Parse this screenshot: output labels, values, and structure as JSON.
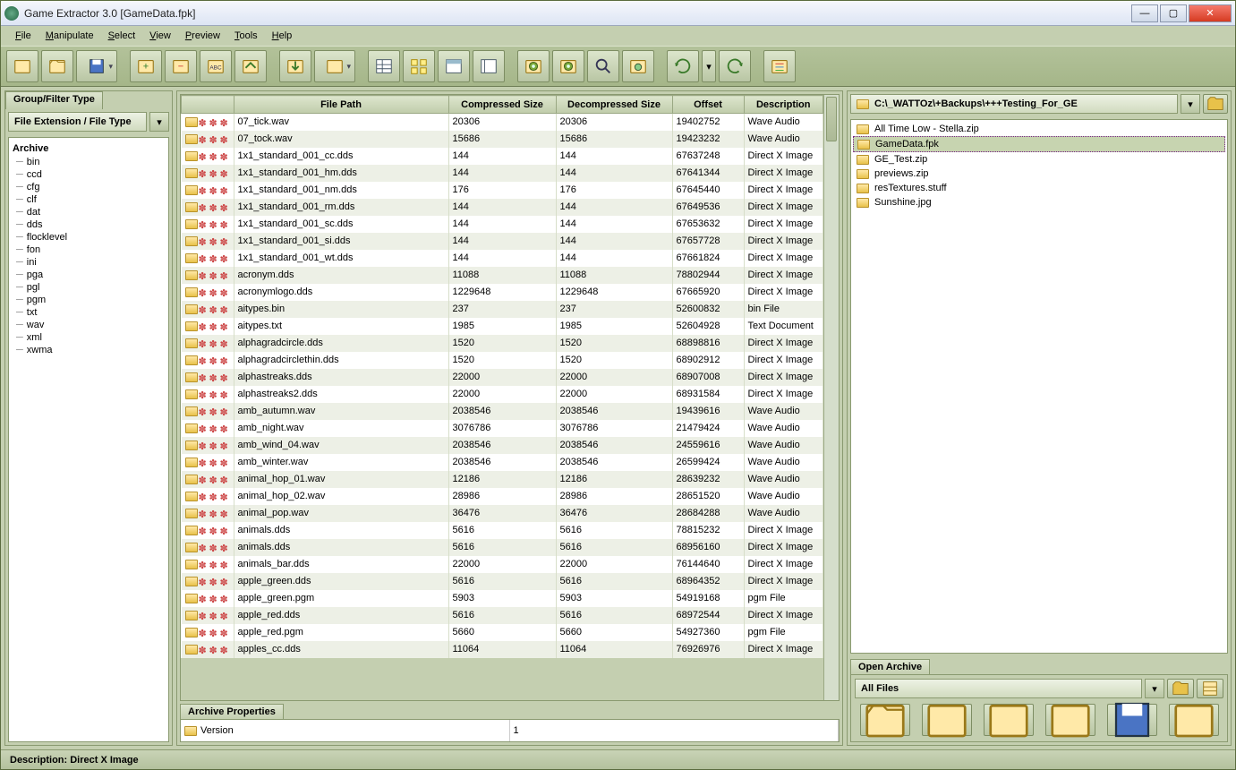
{
  "window": {
    "title": "Game Extractor 3.0 [GameData.fpk]"
  },
  "menu": [
    "File",
    "Manipulate",
    "Select",
    "View",
    "Preview",
    "Tools",
    "Help"
  ],
  "toolbar_icons": [
    "new",
    "open",
    "save",
    "add-file",
    "remove-file",
    "rename-abc",
    "replace-file",
    "extract",
    "extract-dropdown",
    "table-view",
    "thumb-view",
    "group-view",
    "tree-view",
    "hex",
    "script",
    "search",
    "preview",
    "undo",
    "undo-dd",
    "redo",
    "options"
  ],
  "left": {
    "tab": "Group/Filter Type",
    "combo": "File Extension / File Type",
    "tree_root": "Archive",
    "tree": [
      "bin",
      "ccd",
      "cfg",
      "clf",
      "dat",
      "dds",
      "flocklevel",
      "fon",
      "ini",
      "pga",
      "pgl",
      "pgm",
      "txt",
      "wav",
      "xml",
      "xwma"
    ]
  },
  "table": {
    "headers": [
      "",
      "File Path",
      "Compressed Size",
      "Decompressed Size",
      "Offset",
      "Description"
    ],
    "rows": [
      [
        "07_tick.wav",
        "20306",
        "20306",
        "19402752",
        "Wave Audio"
      ],
      [
        "07_tock.wav",
        "15686",
        "15686",
        "19423232",
        "Wave Audio"
      ],
      [
        "1x1_standard_001_cc.dds",
        "144",
        "144",
        "67637248",
        "Direct X Image"
      ],
      [
        "1x1_standard_001_hm.dds",
        "144",
        "144",
        "67641344",
        "Direct X Image"
      ],
      [
        "1x1_standard_001_nm.dds",
        "176",
        "176",
        "67645440",
        "Direct X Image"
      ],
      [
        "1x1_standard_001_rm.dds",
        "144",
        "144",
        "67649536",
        "Direct X Image"
      ],
      [
        "1x1_standard_001_sc.dds",
        "144",
        "144",
        "67653632",
        "Direct X Image"
      ],
      [
        "1x1_standard_001_si.dds",
        "144",
        "144",
        "67657728",
        "Direct X Image"
      ],
      [
        "1x1_standard_001_wt.dds",
        "144",
        "144",
        "67661824",
        "Direct X Image"
      ],
      [
        "acronym.dds",
        "11088",
        "11088",
        "78802944",
        "Direct X Image"
      ],
      [
        "acronymlogo.dds",
        "1229648",
        "1229648",
        "67665920",
        "Direct X Image"
      ],
      [
        "aitypes.bin",
        "237",
        "237",
        "52600832",
        "bin File"
      ],
      [
        "aitypes.txt",
        "1985",
        "1985",
        "52604928",
        "Text Document"
      ],
      [
        "alphagradcircle.dds",
        "1520",
        "1520",
        "68898816",
        "Direct X Image"
      ],
      [
        "alphagradcirclethin.dds",
        "1520",
        "1520",
        "68902912",
        "Direct X Image"
      ],
      [
        "alphastreaks.dds",
        "22000",
        "22000",
        "68907008",
        "Direct X Image"
      ],
      [
        "alphastreaks2.dds",
        "22000",
        "22000",
        "68931584",
        "Direct X Image"
      ],
      [
        "amb_autumn.wav",
        "2038546",
        "2038546",
        "19439616",
        "Wave Audio"
      ],
      [
        "amb_night.wav",
        "3076786",
        "3076786",
        "21479424",
        "Wave Audio"
      ],
      [
        "amb_wind_04.wav",
        "2038546",
        "2038546",
        "24559616",
        "Wave Audio"
      ],
      [
        "amb_winter.wav",
        "2038546",
        "2038546",
        "26599424",
        "Wave Audio"
      ],
      [
        "animal_hop_01.wav",
        "12186",
        "12186",
        "28639232",
        "Wave Audio"
      ],
      [
        "animal_hop_02.wav",
        "28986",
        "28986",
        "28651520",
        "Wave Audio"
      ],
      [
        "animal_pop.wav",
        "36476",
        "36476",
        "28684288",
        "Wave Audio"
      ],
      [
        "animals.dds",
        "5616",
        "5616",
        "78815232",
        "Direct X Image"
      ],
      [
        "animals.dds",
        "5616",
        "5616",
        "68956160",
        "Direct X Image"
      ],
      [
        "animals_bar.dds",
        "22000",
        "22000",
        "76144640",
        "Direct X Image"
      ],
      [
        "apple_green.dds",
        "5616",
        "5616",
        "68964352",
        "Direct X Image"
      ],
      [
        "apple_green.pgm",
        "5903",
        "5903",
        "54919168",
        "pgm File"
      ],
      [
        "apple_red.dds",
        "5616",
        "5616",
        "68972544",
        "Direct X Image"
      ],
      [
        "apple_red.pgm",
        "5660",
        "5660",
        "54927360",
        "pgm File"
      ],
      [
        "apples_cc.dds",
        "11064",
        "11064",
        "76926976",
        "Direct X Image"
      ]
    ]
  },
  "archive_props": {
    "tab": "Archive Properties",
    "key": "Version",
    "value": "1"
  },
  "right": {
    "path": "C:\\_WATTOz\\+Backups\\+++Testing_For_GE",
    "files": [
      {
        "name": "All Time Low - Stella.zip",
        "selected": false
      },
      {
        "name": "GameData.fpk",
        "selected": true
      },
      {
        "name": "GE_Test.zip",
        "selected": false
      },
      {
        "name": "previews.zip",
        "selected": false
      },
      {
        "name": "resTextures.stuff",
        "selected": false
      },
      {
        "name": "Sunshine.jpg",
        "selected": false
      }
    ],
    "open_tab": "Open Archive",
    "all_files": "All Files",
    "buttons": [
      "open",
      "list",
      "new",
      "cut",
      "save",
      "scissors"
    ]
  },
  "status": "Description: Direct X Image"
}
